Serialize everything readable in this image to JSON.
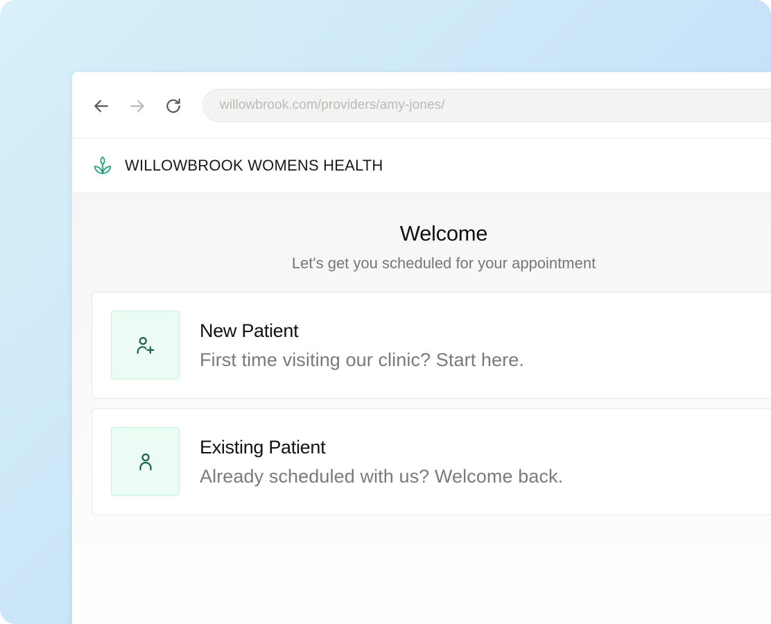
{
  "browser": {
    "url": "willowbrook.com/providers/amy-jones/",
    "nav_icons": [
      "arrow-left-icon",
      "arrow-right-icon",
      "reload-icon"
    ]
  },
  "site": {
    "brand_name": "WILLOWBROOK WOMENS HEALTH",
    "logo_icon": "sprout-icon",
    "accent_color": "#1aa575"
  },
  "welcome": {
    "title": "Welcome",
    "subtitle": "Let's get you scheduled for your appointment"
  },
  "options": [
    {
      "title": "New Patient",
      "description": "First time visiting our clinic? Start here.",
      "icon": "user-plus-icon"
    },
    {
      "title": "Existing Patient",
      "description": "Already scheduled with us? Welcome back.",
      "icon": "user-icon"
    }
  ],
  "colors": {
    "icon_box_bg": "#ecfbf4",
    "icon_color": "#17654a"
  }
}
